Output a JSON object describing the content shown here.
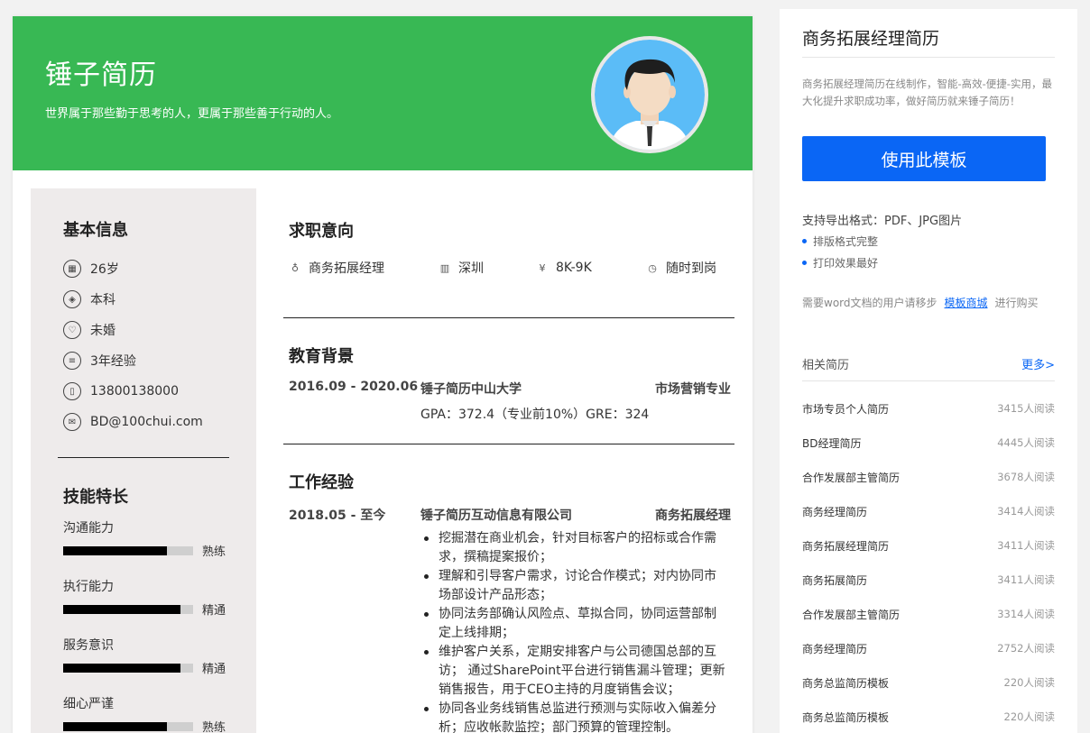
{
  "resume": {
    "name": "锤子简历",
    "motto": "世界属于那些勤于思考的人，更属于那些善于行动的人。",
    "basic_title": "基本信息",
    "basic_info": [
      {
        "icon": "calendar-icon",
        "glyph": "▦",
        "text": "26岁"
      },
      {
        "icon": "education-icon",
        "glyph": "◈",
        "text": "本科"
      },
      {
        "icon": "marriage-icon",
        "glyph": "♡",
        "text": "未婚"
      },
      {
        "icon": "experience-icon",
        "glyph": "≡",
        "text": "3年经验"
      },
      {
        "icon": "phone-icon",
        "glyph": "▯",
        "text": "13800138000"
      },
      {
        "icon": "email-icon",
        "glyph": "✉",
        "text": "BD@100chui.com"
      }
    ],
    "skills_title": "技能特长",
    "skills": [
      {
        "name": "沟通能力",
        "level": "熟练",
        "value": 0.8
      },
      {
        "name": "执行能力",
        "level": "精通",
        "value": 0.9
      },
      {
        "name": "服务意识",
        "level": "精通",
        "value": 0.9
      },
      {
        "name": "细心严谨",
        "level": "熟练",
        "value": 0.8
      }
    ],
    "intent_title": "求职意向",
    "intent": [
      {
        "icon": "tie-icon",
        "glyph": "♁",
        "text": "商务拓展经理"
      },
      {
        "icon": "building-icon",
        "glyph": "▥",
        "text": "深圳"
      },
      {
        "icon": "yen-icon",
        "glyph": "¥",
        "text": "8K-9K"
      },
      {
        "icon": "clock-icon",
        "glyph": "◷",
        "text": "随时到岗"
      }
    ],
    "edu_title": "教育背景",
    "edu": {
      "date": "2016.09 - 2020.06",
      "school": "锤子简历中山大学",
      "major": "市场营销专业",
      "detail": "GPA：372.4（专业前10%）GRE：324"
    },
    "work_title": "工作经验",
    "work": {
      "date": "2018.05 - 至今",
      "company": "锤子简历互动信息有限公司",
      "role": "商务拓展经理",
      "duties": [
        "挖掘潜在商业机会，针对目标客户的招标或合作需求，撰稿提案报价；",
        "理解和引导客户需求，讨论合作模式；对内协同市场部设计产品形态；",
        "协同法务部确认风险点、草拟合同，协同运营部制定上线排期；",
        "维护客户关系，定期安排客户与公司德国总部的互访；  通过SharePoint平台进行销售漏斗管理；更新销售报告，用于CEO主持的月度销售会议；",
        "协同各业务线销售总监进行预测与实际收入偏差分析；应收帐款监控；部门预算的管理控制。"
      ]
    }
  },
  "sidebar": {
    "title": "商务拓展经理简历",
    "desc": "商务拓展经理简历在线制作，智能-高效-便捷-实用，最大化提升求职成功率，做好简历就来锤子简历！",
    "use_button": "使用此模板",
    "export": "支持导出格式：PDF、JPG图片",
    "features": [
      "排版格式完整",
      "打印效果最好"
    ],
    "word_note_prefix": "需要word文档的用户请移步",
    "word_note_link": "模板商城",
    "word_note_suffix": "进行购买",
    "related_title": "相关简历",
    "more": "更多>",
    "related": [
      {
        "title": "市场专员个人简历",
        "reads": "3415人阅读"
      },
      {
        "title": "BD经理简历",
        "reads": "4445人阅读"
      },
      {
        "title": "合作发展部主管简历",
        "reads": "3678人阅读"
      },
      {
        "title": "商务经理简历",
        "reads": "3414人阅读"
      },
      {
        "title": "商务拓展经理简历",
        "reads": "3411人阅读"
      },
      {
        "title": "商务拓展简历",
        "reads": "3411人阅读"
      },
      {
        "title": "合作发展部主管简历",
        "reads": "3314人阅读"
      },
      {
        "title": "商务经理简历",
        "reads": "2752人阅读"
      },
      {
        "title": "商务总监简历模板",
        "reads": "220人阅读"
      },
      {
        "title": "商务总监简历模板",
        "reads": "220人阅读"
      }
    ]
  },
  "colors": {
    "header_green": "#38b854",
    "accent_blue": "#0a66f5",
    "left_panel": "#eeebeb"
  }
}
